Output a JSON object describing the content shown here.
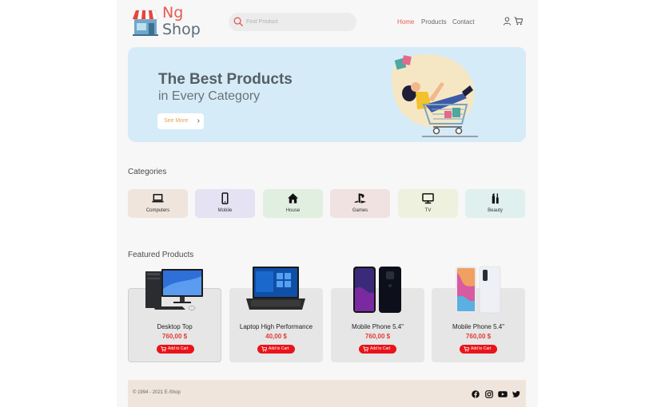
{
  "brand": {
    "name_line1": "Ng",
    "name_line2": "Shop",
    "logo_icon": "storefront-icon"
  },
  "search": {
    "placeholder": "Find Product",
    "icon": "search-icon"
  },
  "nav": [
    {
      "label": "Home",
      "active": true
    },
    {
      "label": "Products",
      "active": false
    },
    {
      "label": "Contact",
      "active": false
    }
  ],
  "header_icons": [
    "user-icon",
    "cart-icon"
  ],
  "banner": {
    "title": "The Best Products",
    "subtitle": "in Every Category",
    "button_label": "See More",
    "button_icon": "chevron-right-icon",
    "background": "#d6ebf8"
  },
  "categories_title": "Categories",
  "categories": [
    {
      "label": "Computers",
      "icon": "laptop-icon",
      "color": "#efe5dc"
    },
    {
      "label": "Mobile",
      "icon": "phone-icon",
      "color": "#e4e2f3"
    },
    {
      "label": "House",
      "icon": "house-icon",
      "color": "#e1efe1"
    },
    {
      "label": "Games",
      "icon": "playstation-icon",
      "color": "#efe2e0"
    },
    {
      "label": "TV",
      "icon": "tv-icon",
      "color": "#eef1de"
    },
    {
      "label": "Beauty",
      "icon": "beauty-icon",
      "color": "#dff0ef"
    }
  ],
  "featured_title": "Featured Products",
  "products": [
    {
      "name": "Desktop Top",
      "price": "760,00 $",
      "button": "Add to Cart"
    },
    {
      "name": "Laptop High Performance",
      "price": "40,00 $",
      "button": "Add to Cart"
    },
    {
      "name": "Mobile Phone 5.4\"",
      "price": "760,00 $",
      "button": "Add to Cart"
    },
    {
      "name": "Mobile Phone 5.4\"",
      "price": "760,00 $",
      "button": "Add to Cart"
    }
  ],
  "footer": {
    "copyright": "© 1994 - 2021 E-Shop",
    "social": [
      "facebook-icon",
      "instagram-icon",
      "youtube-icon",
      "twitter-icon"
    ]
  },
  "colors": {
    "accent": "#e85a4f",
    "price": "#e53935",
    "add_button": "#e8141a",
    "footer": "#efe5dc"
  }
}
